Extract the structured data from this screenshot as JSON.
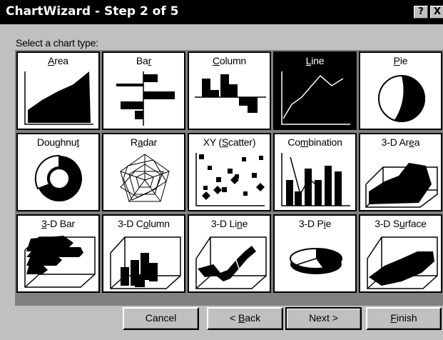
{
  "window": {
    "title": "ChartWizard - Step 2 of 5",
    "help_glyph": "?",
    "close_glyph": "X"
  },
  "prompt": "Select a chart type:",
  "chart_types": [
    {
      "label": "Area",
      "mnemonic_index": 0,
      "icon": "area-chart-icon",
      "selected": false
    },
    {
      "label": "Bar",
      "mnemonic_index": 2,
      "icon": "bar-chart-icon",
      "selected": false
    },
    {
      "label": "Column",
      "mnemonic_index": 0,
      "icon": "column-chart-icon",
      "selected": false
    },
    {
      "label": "Line",
      "mnemonic_index": 0,
      "icon": "line-chart-icon",
      "selected": true
    },
    {
      "label": "Pie",
      "mnemonic_index": 0,
      "icon": "pie-chart-icon",
      "selected": false
    },
    {
      "label": "Doughnut",
      "mnemonic_index": 7,
      "icon": "doughnut-chart-icon",
      "selected": false
    },
    {
      "label": "Radar",
      "mnemonic_index": 1,
      "icon": "radar-chart-icon",
      "selected": false
    },
    {
      "label": "XY (Scatter)",
      "mnemonic_index": 4,
      "icon": "scatter-chart-icon",
      "selected": false
    },
    {
      "label": "Combination",
      "mnemonic_index": 2,
      "icon": "combination-chart-icon",
      "selected": false
    },
    {
      "label": "3-D Area",
      "mnemonic_index": 6,
      "icon": "3d-area-chart-icon",
      "selected": false
    },
    {
      "label": "3-D Bar",
      "mnemonic_index": 0,
      "icon": "3d-bar-chart-icon",
      "selected": false
    },
    {
      "label": "3-D Column",
      "mnemonic_index": 5,
      "icon": "3d-column-chart-icon",
      "selected": false
    },
    {
      "label": "3-D Line",
      "mnemonic_index": 6,
      "icon": "3d-line-chart-icon",
      "selected": false
    },
    {
      "label": "3-D Pie",
      "mnemonic_index": 5,
      "icon": "3d-pie-chart-icon",
      "selected": false
    },
    {
      "label": "3-D Surface",
      "mnemonic_index": 5,
      "icon": "3d-surface-chart-icon",
      "selected": false
    }
  ],
  "buttons": {
    "cancel": "Cancel",
    "back": "< Back",
    "back_mnemonic_index": 2,
    "next": "Next >",
    "finish": "Finish",
    "finish_mnemonic_index": 0
  },
  "colors": {
    "titlebar": "#000000",
    "dialog": "#c0c0c0",
    "selected_cell": "#000000"
  }
}
